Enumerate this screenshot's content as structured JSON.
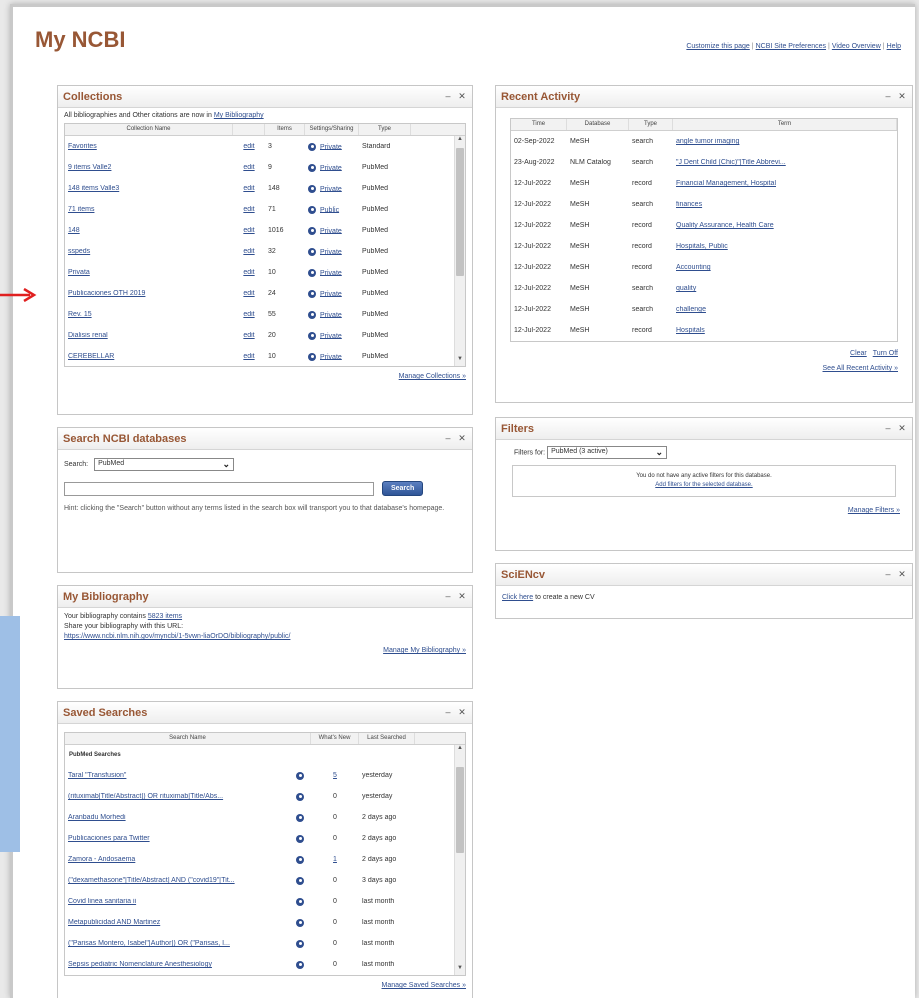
{
  "page_title": "My NCBI",
  "top_links": [
    "Customize this page",
    "NCBI Site Preferences",
    "Video Overview",
    "Help"
  ],
  "collections": {
    "title": "Collections",
    "note_prefix": "All bibliographies and Other citations are now in",
    "note_link": "My Bibliography",
    "headers": [
      "Collection Name",
      "Items",
      "Settings/Sharing",
      "Type"
    ],
    "edit_label": "edit",
    "rows": [
      {
        "name": "Favorites",
        "items": "3",
        "sharing": "Private",
        "type": "Standard"
      },
      {
        "name": "9 items Valle2",
        "items": "9",
        "sharing": "Private",
        "type": "PubMed"
      },
      {
        "name": "148 items Valle3",
        "items": "148",
        "sharing": "Private",
        "type": "PubMed"
      },
      {
        "name": "71 items",
        "items": "71",
        "sharing": "Public",
        "type": "PubMed"
      },
      {
        "name": "148",
        "items": "1016",
        "sharing": "Private",
        "type": "PubMed"
      },
      {
        "name": "sspeds",
        "items": "32",
        "sharing": "Private",
        "type": "PubMed"
      },
      {
        "name": "Privata",
        "items": "10",
        "sharing": "Private",
        "type": "PubMed"
      },
      {
        "name": "Publicaciones OTH 2019",
        "items": "24",
        "sharing": "Private",
        "type": "PubMed"
      },
      {
        "name": "Rev. 15",
        "items": "55",
        "sharing": "Private",
        "type": "PubMed"
      },
      {
        "name": "Dialisis renal",
        "items": "20",
        "sharing": "Private",
        "type": "PubMed"
      },
      {
        "name": "CEREBELLAR",
        "items": "10",
        "sharing": "Private",
        "type": "PubMed"
      }
    ],
    "manage_link": "Manage Collections »"
  },
  "search_db": {
    "title": "Search NCBI databases",
    "search_label": "Search:",
    "db_selected": "PubMed",
    "button_label": "Search",
    "hint": "Hint: clicking the \"Search\" button without any terms listed in the search box will transport you to that database's homepage."
  },
  "bibliography": {
    "title": "My Bibliography",
    "line1_prefix": "Your bibliography contains",
    "line1_link": "5823 items",
    "line2": "Share your bibliography with this URL:",
    "url": "https://www.ncbi.nlm.nih.gov/myncbi/1-5vwn-liaOrDO/bibliography/public/",
    "manage_link": "Manage My Bibliography »"
  },
  "saved_searches": {
    "title": "Saved Searches",
    "headers": [
      "Search Name",
      "What's New",
      "Last Searched"
    ],
    "group_label": "PubMed Searches",
    "rows": [
      {
        "name": "Taral \"Transfusion\"",
        "new": "5",
        "last": "yesterday"
      },
      {
        "name": "(rituximab[Title/Abstract]) OR rituximab[Title/Abs...",
        "new": "0",
        "last": "yesterday"
      },
      {
        "name": "Aranbadu Morhedi",
        "new": "0",
        "last": "2 days ago"
      },
      {
        "name": "Publicaciones para Twitter",
        "new": "0",
        "last": "2 days ago"
      },
      {
        "name": "Zamora - Andosaema",
        "new": "1",
        "last": "2 days ago"
      },
      {
        "name": "(\"dexamethasone\"[Title/Abstract] AND (\"covid19\"[Tit...",
        "new": "0",
        "last": "3 days ago"
      },
      {
        "name": "Covid linea sanitaria ii",
        "new": "0",
        "last": "last month"
      },
      {
        "name": "Metapublicidad AND Martinez",
        "new": "0",
        "last": "last month"
      },
      {
        "name": "(\"Parisas Montero, Isabel\"[Author]) OR (\"Parisas, I...",
        "new": "0",
        "last": "last month"
      },
      {
        "name": "Sepsis pediatric  Nomenclature Anesthesiology",
        "new": "0",
        "last": "last month"
      }
    ],
    "manage_link": "Manage Saved Searches »"
  },
  "recent_activity": {
    "title": "Recent Activity",
    "headers": [
      "Time",
      "Database",
      "Type",
      "Term"
    ],
    "rows": [
      {
        "time": "02-Sep-2022",
        "db": "MeSH",
        "type": "search",
        "term": "angle tumor imaging"
      },
      {
        "time": "23-Aug-2022",
        "db": "NLM Catalog",
        "type": "search",
        "term": "\"J Dent Child (Chic)\"[Title Abbrevi..."
      },
      {
        "time": "12-Jul-2022",
        "db": "MeSH",
        "type": "record",
        "term": "Financial Management, Hospital"
      },
      {
        "time": "12-Jul-2022",
        "db": "MeSH",
        "type": "search",
        "term": "finances"
      },
      {
        "time": "12-Jul-2022",
        "db": "MeSH",
        "type": "record",
        "term": "Quality Assurance, Health Care"
      },
      {
        "time": "12-Jul-2022",
        "db": "MeSH",
        "type": "record",
        "term": "Hospitals, Public"
      },
      {
        "time": "12-Jul-2022",
        "db": "MeSH",
        "type": "record",
        "term": "Accounting"
      },
      {
        "time": "12-Jul-2022",
        "db": "MeSH",
        "type": "search",
        "term": "quality"
      },
      {
        "time": "12-Jul-2022",
        "db": "MeSH",
        "type": "search",
        "term": "challenge"
      },
      {
        "time": "12-Jul-2022",
        "db": "MeSH",
        "type": "record",
        "term": "Hospitals"
      }
    ],
    "clear_link": "Clear",
    "turnoff_link": "Turn Off",
    "see_all_link": "See All Recent Activity »"
  },
  "filters": {
    "title": "Filters",
    "filters_for_label": "Filters for:",
    "db_selected": "PubMed (3 active)",
    "notice": "You do not have any active filters for this database.",
    "add_link": "Add filters for the selected database.",
    "manage_link": "Manage Filters »"
  },
  "sciencv": {
    "title": "SciENcv",
    "link": "Click here",
    "text": "to create a new CV"
  },
  "colors": {
    "title_brown": "#985735",
    "link_blue": "#2f4e8f",
    "arrow_red": "#e02020",
    "side_blue": "#9ebfe6"
  }
}
